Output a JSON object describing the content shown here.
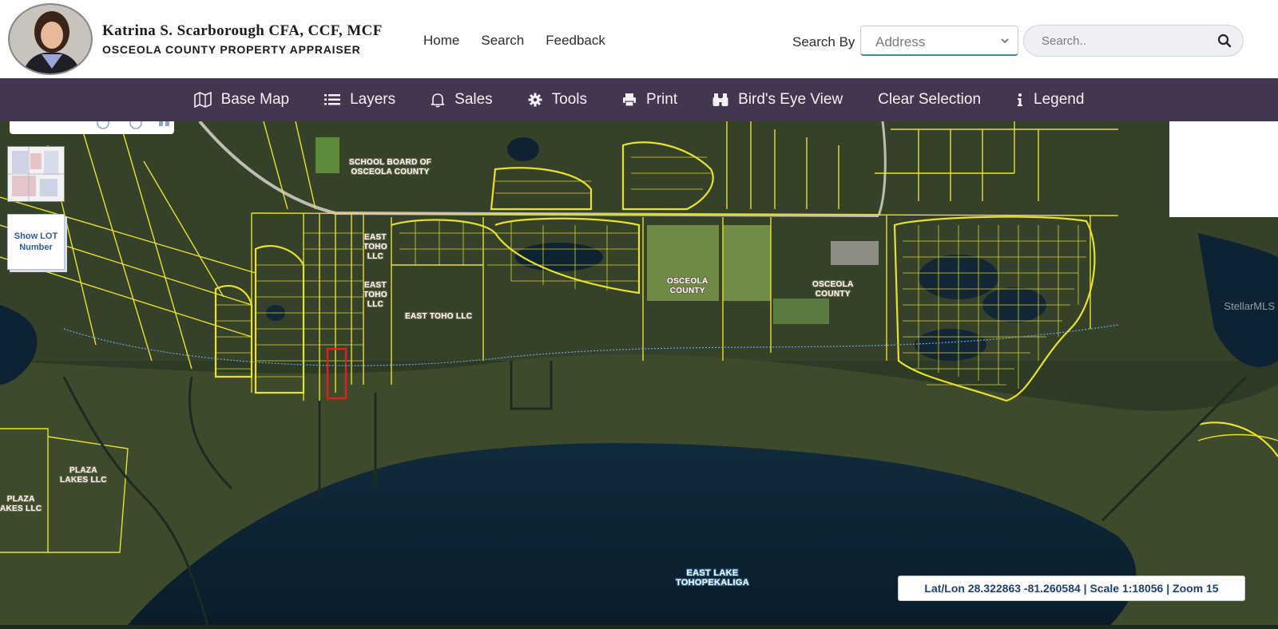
{
  "header": {
    "name": "Katrina S. Scarborough CFA, CCF, MCF",
    "organization": "OSCEOLA COUNTY PROPERTY APPRAISER",
    "nav": [
      "Home",
      "Search",
      "Feedback"
    ],
    "search_by_label": "Search By",
    "search_by_value": "Address",
    "search_placeholder": "Search.."
  },
  "toolbar": {
    "items": [
      {
        "label": "Base Map",
        "icon": "map-icon"
      },
      {
        "label": "Layers",
        "icon": "list-icon"
      },
      {
        "label": "Sales",
        "icon": "bell-icon"
      },
      {
        "label": "Tools",
        "icon": "gear-icon"
      },
      {
        "label": "Print",
        "icon": "printer-icon"
      },
      {
        "label": "Bird's Eye View",
        "icon": "binoculars-icon"
      },
      {
        "label": "Clear Selection",
        "icon": ""
      },
      {
        "label": "Legend",
        "icon": "info-icon"
      }
    ]
  },
  "map": {
    "show_lot_button": "Show LOT Number",
    "watermark": "StellarMLS",
    "labels": {
      "school_line1": "SCHOOL BOARD OF",
      "school_line2": "OSCEOLA COUNTY",
      "east_toho_1a": "EAST",
      "east_toho_1b": "TOHO",
      "east_toho_1c": "LLC",
      "east_toho_2a": "EAST",
      "east_toho_2b": "TOHO",
      "east_toho_2c": "LLC",
      "east_toho_llc": "EAST TOHO LLC",
      "osceola_1a": "OSCEOLA",
      "osceola_1b": "COUNTY",
      "osceola_2a": "OSCEOLA",
      "osceola_2b": "COUNTY",
      "plaza_1a": "PLAZA",
      "plaza_1b": "LAKES LLC",
      "plaza_2a": "PLAZA",
      "plaza_2b": "AKES LLC",
      "lake_1": "EAST LAKE",
      "lake_2": "TOHOPEKALIGA"
    },
    "status": "Lat/Lon 28.322863 -81.260584 | Scale 1:18056 | Zoom 15",
    "colors": {
      "parcel": "#e8e22a",
      "selected": "#e02020",
      "toolbar": "#44364f"
    }
  }
}
